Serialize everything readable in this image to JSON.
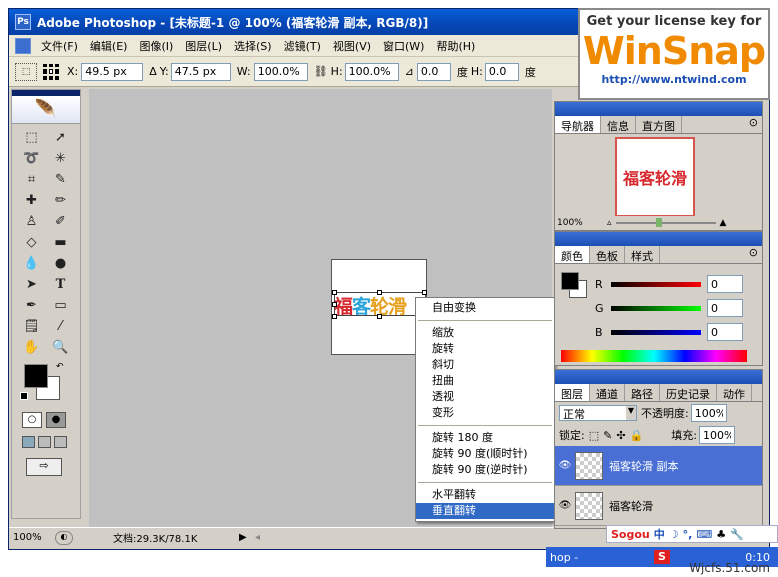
{
  "window": {
    "title": "Adobe Photoshop - [未标题-1 @ 100% (福客轮滑 副本, RGB/8)]"
  },
  "menu": {
    "items": [
      "文件(F)",
      "编辑(E)",
      "图像(I)",
      "图层(L)",
      "选择(S)",
      "滤镜(T)",
      "视图(V)",
      "窗口(W)",
      "帮助(H)"
    ]
  },
  "options": {
    "x_label": "X:",
    "x_value": "49.5 px",
    "y_label": "Y:",
    "y_value": "47.5 px",
    "w_label": "W:",
    "w_value": "100.0%",
    "h_label": "H:",
    "h_value": "100.0%",
    "angle_value": "0.0",
    "angle_unit": "度",
    "hskew_label": "H:",
    "hskew_value": "0.0",
    "hskew_unit": "度"
  },
  "document": {
    "text_chars": [
      "福",
      "客",
      "轮",
      "滑"
    ],
    "text_colors": [
      "#d6282d",
      "#2aa3d8",
      "#e6a020",
      "#e6a020"
    ]
  },
  "context_menu": {
    "group1": [
      "自由变换"
    ],
    "group2": [
      "缩放",
      "旋转",
      "斜切",
      "扭曲",
      "透视",
      "变形"
    ],
    "group3": [
      "旋转 180 度",
      "旋转 90 度(顺时针)",
      "旋转 90 度(逆时针)"
    ],
    "group4": [
      "水平翻转",
      "垂直翻转"
    ],
    "selected": "垂直翻转"
  },
  "status": {
    "zoom": "100%",
    "doc_info": "文档:29.3K/78.1K"
  },
  "navigator": {
    "tabs": [
      "导航器",
      "信息",
      "直方图"
    ],
    "preview_text": "福客轮滑",
    "zoom": "100%"
  },
  "color_panel": {
    "tabs": [
      "颜色",
      "色板",
      "样式"
    ],
    "r_label": "R",
    "g_label": "G",
    "b_label": "B",
    "r_value": "0",
    "g_value": "0",
    "b_value": "0"
  },
  "layers_panel": {
    "tabs": [
      "图层",
      "通道",
      "路径",
      "历史记录",
      "动作"
    ],
    "blend_mode": "正常",
    "opacity_label": "不透明度:",
    "opacity_value": "100%",
    "lock_label": "锁定:",
    "fill_label": "填充:",
    "fill_value": "100%",
    "layers": [
      {
        "name": "福客轮滑 副本",
        "selected": true
      },
      {
        "name": "福客轮滑",
        "selected": false
      }
    ]
  },
  "banner": {
    "line1": "Get your license key for",
    "brand": "WinSnap",
    "url": "http://www.ntwind.com"
  },
  "taskbar": {
    "ime": "Sogou",
    "ime_label": "中",
    "partial_text": "hop -",
    "clock": "0:10"
  },
  "watermark": "Wjcfs.51.com",
  "colors": {
    "accent": "#316ac5",
    "title_blue": "#0a5fd8",
    "red_text": "#d6282d",
    "cyan_text": "#2aa3d8",
    "orange_text": "#e6a020"
  }
}
